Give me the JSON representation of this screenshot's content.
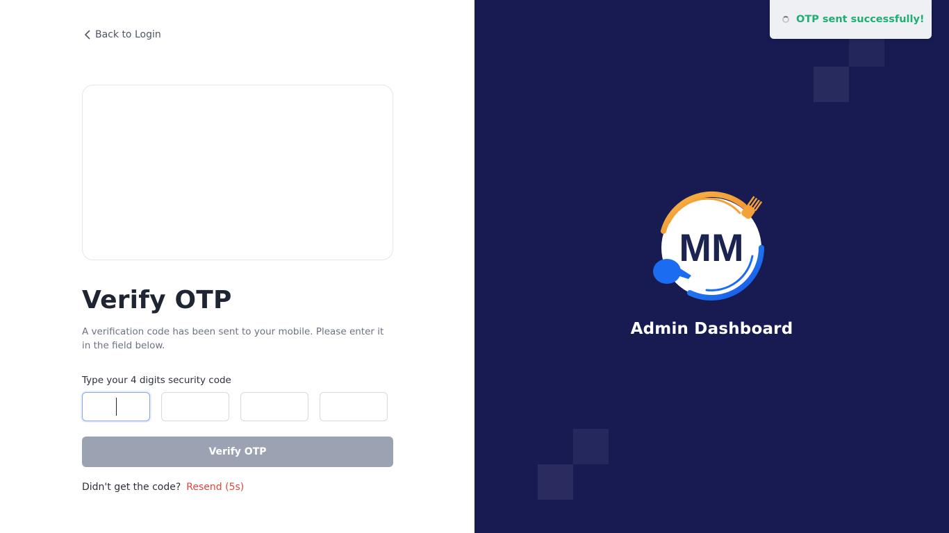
{
  "nav": {
    "back_label": "Back to Login"
  },
  "form": {
    "title": "Verify OTP",
    "subtitle": "A verification code has been sent to your mobile. Please enter it in the field below.",
    "code_label": "Type your 4 digits security code",
    "otp_digits": [
      "",
      "",
      "",
      ""
    ],
    "verify_label": "Verify OTP",
    "resend_prompt": "Didn't get the code?",
    "resend_label": "Resend (5s)"
  },
  "brand": {
    "logo_text": "MM",
    "title": "Admin Dashboard",
    "colors": {
      "panel": "#181b52",
      "accent_orange": "#f5a13a",
      "accent_blue": "#1c6cf2"
    }
  },
  "toast": {
    "message": "OTP sent successfully!",
    "color": "#1fae74"
  },
  "colors": {
    "button_disabled": "#9ba3b2",
    "resend": "#e0443e",
    "focus": "#8aa4ee"
  }
}
